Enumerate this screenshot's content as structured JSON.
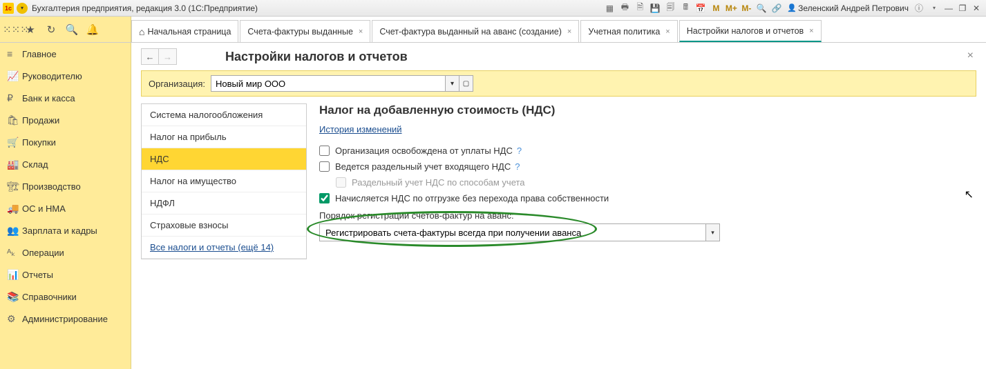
{
  "titlebar": {
    "app_title": "Бухгалтерия предприятия, редакция 3.0  (1С:Предприятие)",
    "m_labels": [
      "M",
      "M+",
      "M-"
    ],
    "user_name": "Зеленский Андрей Петрович"
  },
  "tabs": [
    {
      "label": "Начальная страница",
      "closable": false,
      "home": true
    },
    {
      "label": "Счета-фактуры выданные",
      "closable": true
    },
    {
      "label": "Счет-фактура выданный на аванс (создание)",
      "closable": true
    },
    {
      "label": "Учетная политика",
      "closable": true
    },
    {
      "label": "Настройки налогов и отчетов",
      "closable": true,
      "active": true
    }
  ],
  "sidebar": [
    {
      "icon": "≡",
      "label": "Главное"
    },
    {
      "icon": "📈",
      "label": "Руководителю"
    },
    {
      "icon": "₽",
      "label": "Банк и касса"
    },
    {
      "icon": "🛍",
      "label": "Продажи"
    },
    {
      "icon": "🛒",
      "label": "Покупки"
    },
    {
      "icon": "🏭",
      "label": "Склад"
    },
    {
      "icon": "🏗",
      "label": "Производство"
    },
    {
      "icon": "🚚",
      "label": "ОС и НМА"
    },
    {
      "icon": "👥",
      "label": "Зарплата и кадры"
    },
    {
      "icon": "ᴬₖ",
      "label": "Операции"
    },
    {
      "icon": "📊",
      "label": "Отчеты"
    },
    {
      "icon": "📚",
      "label": "Справочники"
    },
    {
      "icon": "⚙",
      "label": "Администрирование"
    }
  ],
  "page": {
    "title": "Настройки налогов и отчетов",
    "org_label": "Организация:",
    "org_value": "Новый мир ООО"
  },
  "settings_nav": [
    {
      "label": "Система налогообложения"
    },
    {
      "label": "Налог на прибыль"
    },
    {
      "label": "НДС",
      "active": true
    },
    {
      "label": "Налог на имущество"
    },
    {
      "label": "НДФЛ"
    },
    {
      "label": "Страховые взносы"
    },
    {
      "label": "Все налоги и отчеты (ещё 14)",
      "link": true
    }
  ],
  "panel": {
    "title": "Налог на добавленную стоимость (НДС)",
    "history_link": "История изменений",
    "checks": [
      {
        "label": "Организация освобождена от уплаты НДС",
        "checked": false,
        "help": true
      },
      {
        "label": "Ведется раздельный учет входящего НДС",
        "checked": false,
        "help": true
      },
      {
        "label": "Раздельный учет НДС по способам учета",
        "checked": false,
        "sub": true,
        "disabled": true
      },
      {
        "label": "Начисляется НДС по отгрузке без перехода права собственности",
        "checked": true
      }
    ],
    "select_label": "Порядок регистрации счетов-фактур на аванс:",
    "select_value": "Регистрировать счета-фактуры всегда при получении аванса"
  }
}
